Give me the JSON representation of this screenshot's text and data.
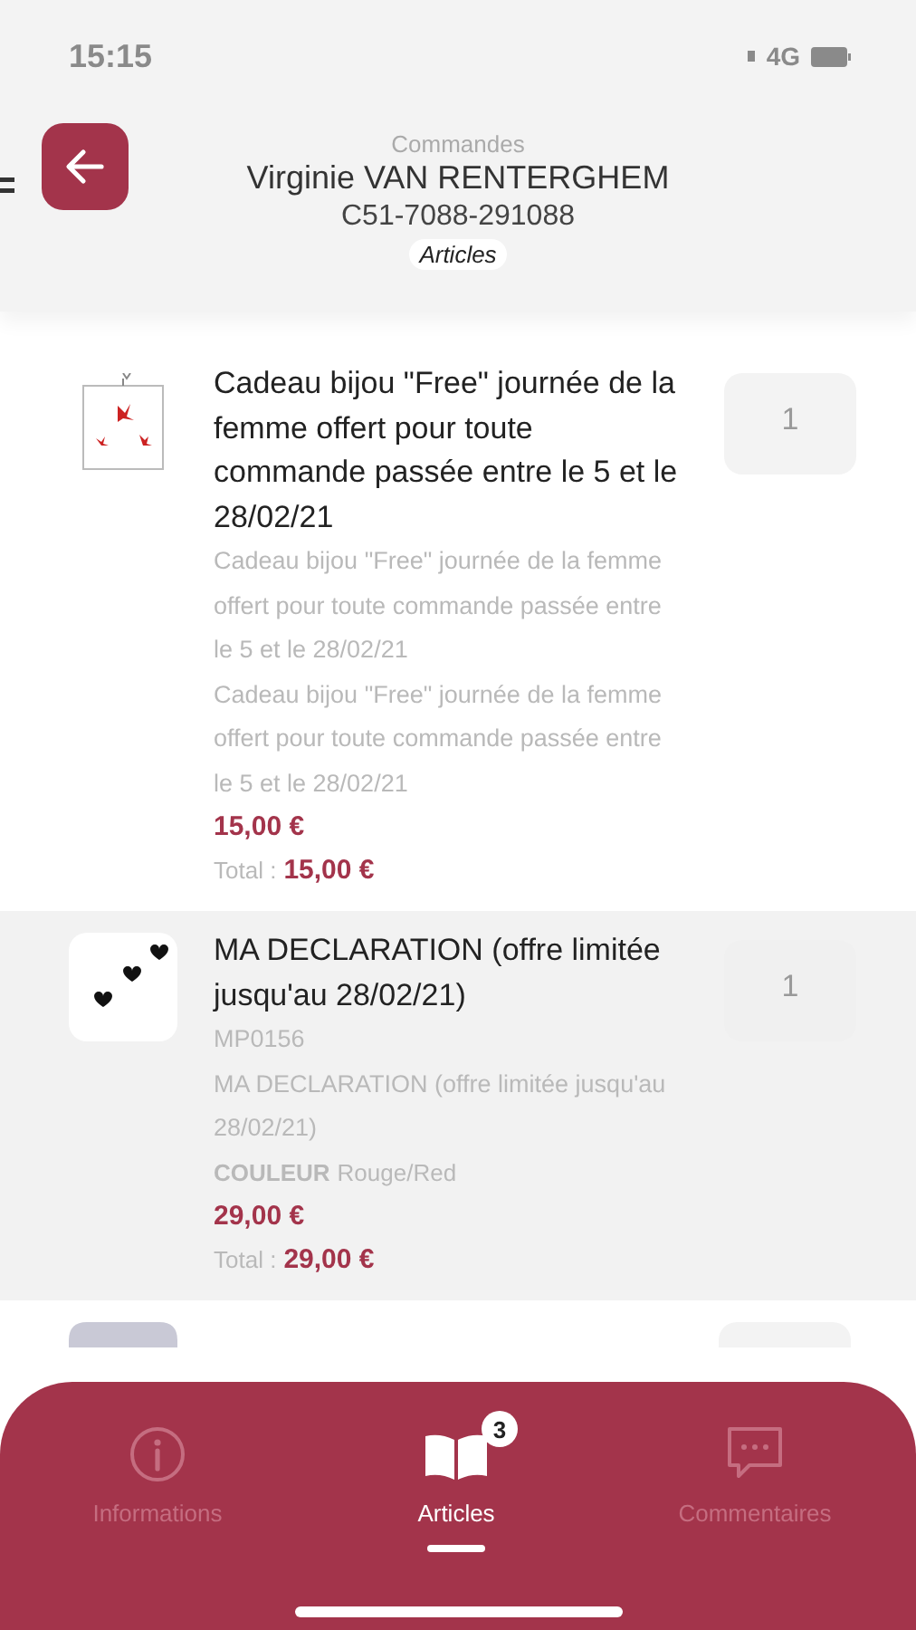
{
  "status_bar": {
    "time": "15:15",
    "network": "4G"
  },
  "header": {
    "section": "Commandes",
    "customer": "Virginie VAN RENTERGHEM",
    "order_number": "C51-7088-291088",
    "view": "Articles"
  },
  "items": [
    {
      "kind": "butterflies",
      "shaded": false,
      "title": "Cadeau bijou \"Free\" journée de la femme offert pour toute commande passée entre le 5 et le 28/02/21",
      "details": [
        "Cadeau bijou \"Free\" journée de la femme offert pour toute commande passée entre le 5 et le 28/02/21",
        "Cadeau bijou \"Free\" journée de la femme offert pour toute commande passée entre le 5 et le 28/02/21"
      ],
      "price": "15,00 €",
      "total_label": "Total :",
      "total": "15,00 €",
      "quantity": "1"
    },
    {
      "kind": "hearts",
      "shaded": true,
      "title": "MA DECLARATION (offre limitée jusqu'au 28/02/21)",
      "details": [
        "MP0156",
        "MA DECLARATION (offre limitée jusqu'au 28/02/21)"
      ],
      "attribute": {
        "name": "COULEUR",
        "value": "Rouge/Red"
      },
      "price": "29,00 €",
      "total_label": "Total :",
      "total": "29,00 €",
      "quantity": "1"
    },
    {
      "kind": "partial"
    }
  ],
  "tabs": [
    {
      "label": "Informations",
      "selected": false
    },
    {
      "label": "Articles",
      "selected": true,
      "badge": "3"
    },
    {
      "label": "Commentaires",
      "selected": false
    }
  ]
}
